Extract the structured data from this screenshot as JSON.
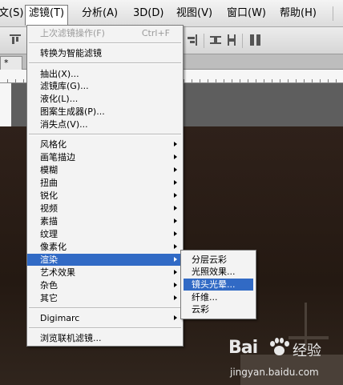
{
  "menubar": {
    "items": [
      "文(S)",
      "滤镜(T)",
      "分析(A)",
      "3D(D)",
      "视图(V)",
      "窗口(W)",
      "帮助(H)"
    ],
    "active": "滤镜(T)"
  },
  "doc_tab": {
    "label": "*"
  },
  "filter_menu": {
    "last_filter": {
      "label": "上次滤镜操作(F)",
      "shortcut": "Ctrl+F",
      "disabled": true
    },
    "smart": "转换为智能滤镜",
    "group1": [
      "抽出(X)...",
      "滤镜库(G)...",
      "液化(L)...",
      "图案生成器(P)...",
      "消失点(V)..."
    ],
    "group2": [
      "风格化",
      "画笔描边",
      "模糊",
      "扭曲",
      "锐化",
      "视频",
      "素描",
      "纹理",
      "像素化",
      "渲染",
      "艺术效果",
      "杂色",
      "其它"
    ],
    "selected": "渲染",
    "digimarc": "Digimarc",
    "browse": "浏览联机滤镜..."
  },
  "render_submenu": {
    "items": [
      "分层云彩",
      "光照效果...",
      "镜头光晕...",
      "纤维...",
      "云彩"
    ],
    "selected": "镜头光晕..."
  },
  "watermark": {
    "brand": "Bai",
    "brand2": "经验",
    "url": "jingyan.baidu.com"
  }
}
